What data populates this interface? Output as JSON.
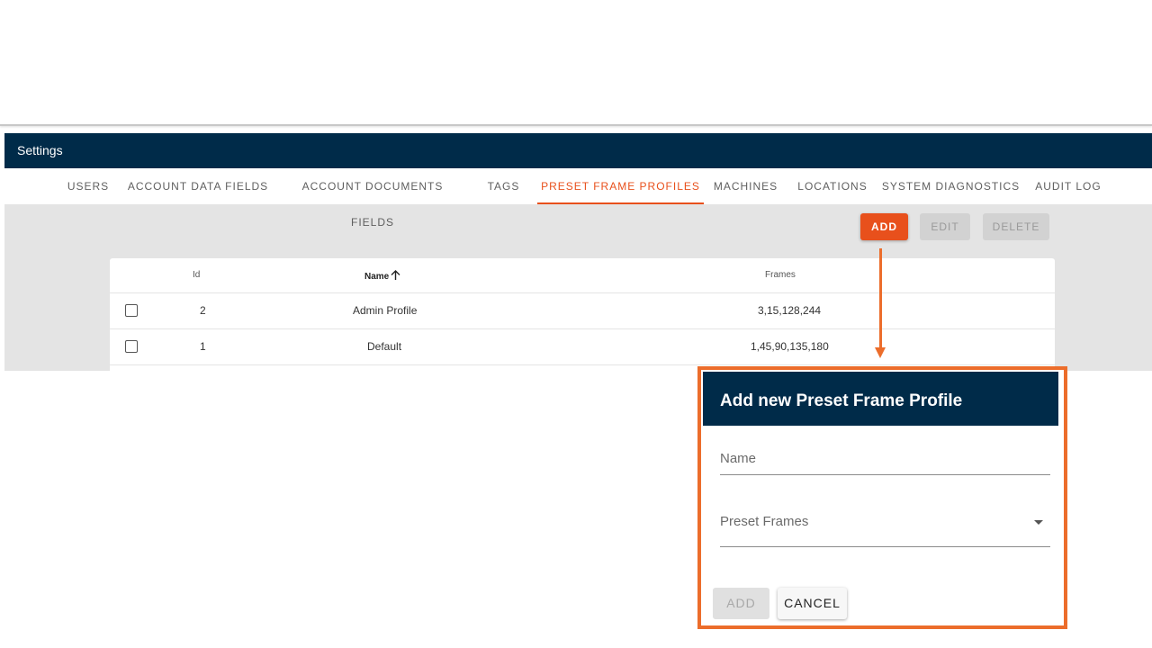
{
  "app": {
    "title": "Settings"
  },
  "tabs": [
    {
      "label": "USERS",
      "active": false
    },
    {
      "label": "ACCOUNT DATA FIELDS",
      "active": false
    },
    {
      "label": "ACCOUNT DOCUMENTS FIELDS",
      "active": false
    },
    {
      "label": "TAGS",
      "active": false
    },
    {
      "label": "PRESET FRAME PROFILES",
      "active": true
    },
    {
      "label": "MACHINES",
      "active": false
    },
    {
      "label": "LOCATIONS",
      "active": false
    },
    {
      "label": "SYSTEM DIAGNOSTICS",
      "active": false
    },
    {
      "label": "AUDIT LOG",
      "active": false
    }
  ],
  "toolbar": {
    "add_label": "ADD",
    "edit_label": "EDIT",
    "delete_label": "DELETE",
    "edit_disabled": true,
    "delete_disabled": true
  },
  "table": {
    "columns": {
      "id": "Id",
      "name": "Name",
      "frames": "Frames"
    },
    "sort": {
      "column": "name",
      "direction": "ascending",
      "icon": "arrow-up-icon"
    },
    "rows": [
      {
        "id": "2",
        "name": "Admin Profile",
        "frames": "3,15,128,244",
        "checked": false
      },
      {
        "id": "1",
        "name": "Default",
        "frames": "1,45,90,135,180",
        "checked": false
      }
    ]
  },
  "dialog": {
    "title": "Add new Preset Frame Profile",
    "name_label": "Name",
    "name_value": "",
    "preset_frames_label": "Preset Frames",
    "preset_frames_value": "",
    "add_label": "ADD",
    "add_disabled": true,
    "cancel_label": "CANCEL"
  },
  "colors": {
    "header_bg": "#002b49",
    "accent": "#e8501c",
    "annotation": "#ec6d2b",
    "panel_bg": "#e4e4e4"
  }
}
